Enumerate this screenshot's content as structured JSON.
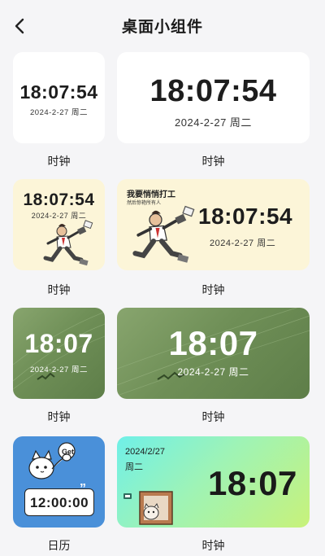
{
  "header": {
    "title": "桌面小组件",
    "back_icon": "chevron-left-icon"
  },
  "widgets": [
    {
      "time": "18:07:54",
      "date": "2024-2-27 周二",
      "label": "时钟"
    },
    {
      "time": "18:07:54",
      "date": "2024-2-27 周二",
      "label": "时钟"
    },
    {
      "time": "18:07:54",
      "date": "2024-2-27 周二",
      "label": "时钟"
    },
    {
      "time": "18:07:54",
      "date": "2024-2-27 周二",
      "label": "时钟",
      "banner_title": "我要悄悄打工",
      "banner_sub": "然后惊艳所有人"
    },
    {
      "time": "18:07",
      "date": "2024-2-27 周二",
      "label": "时钟"
    },
    {
      "time": "18:07",
      "date": "2024-2-27 周二",
      "label": "时钟"
    },
    {
      "time": "12:00:00",
      "label": "日历",
      "bubble": "Get"
    },
    {
      "time": "18:07",
      "date": "2024/2/27",
      "weekday": "周二",
      "label": "时钟"
    }
  ],
  "colors": {
    "green_dark": "#5e7e49",
    "green_light": "#88a56e",
    "cream": "#fcf5d8",
    "blue": "#4a90d9",
    "mint_to_lime": [
      "#6ff0e8",
      "#c8f27a"
    ]
  }
}
